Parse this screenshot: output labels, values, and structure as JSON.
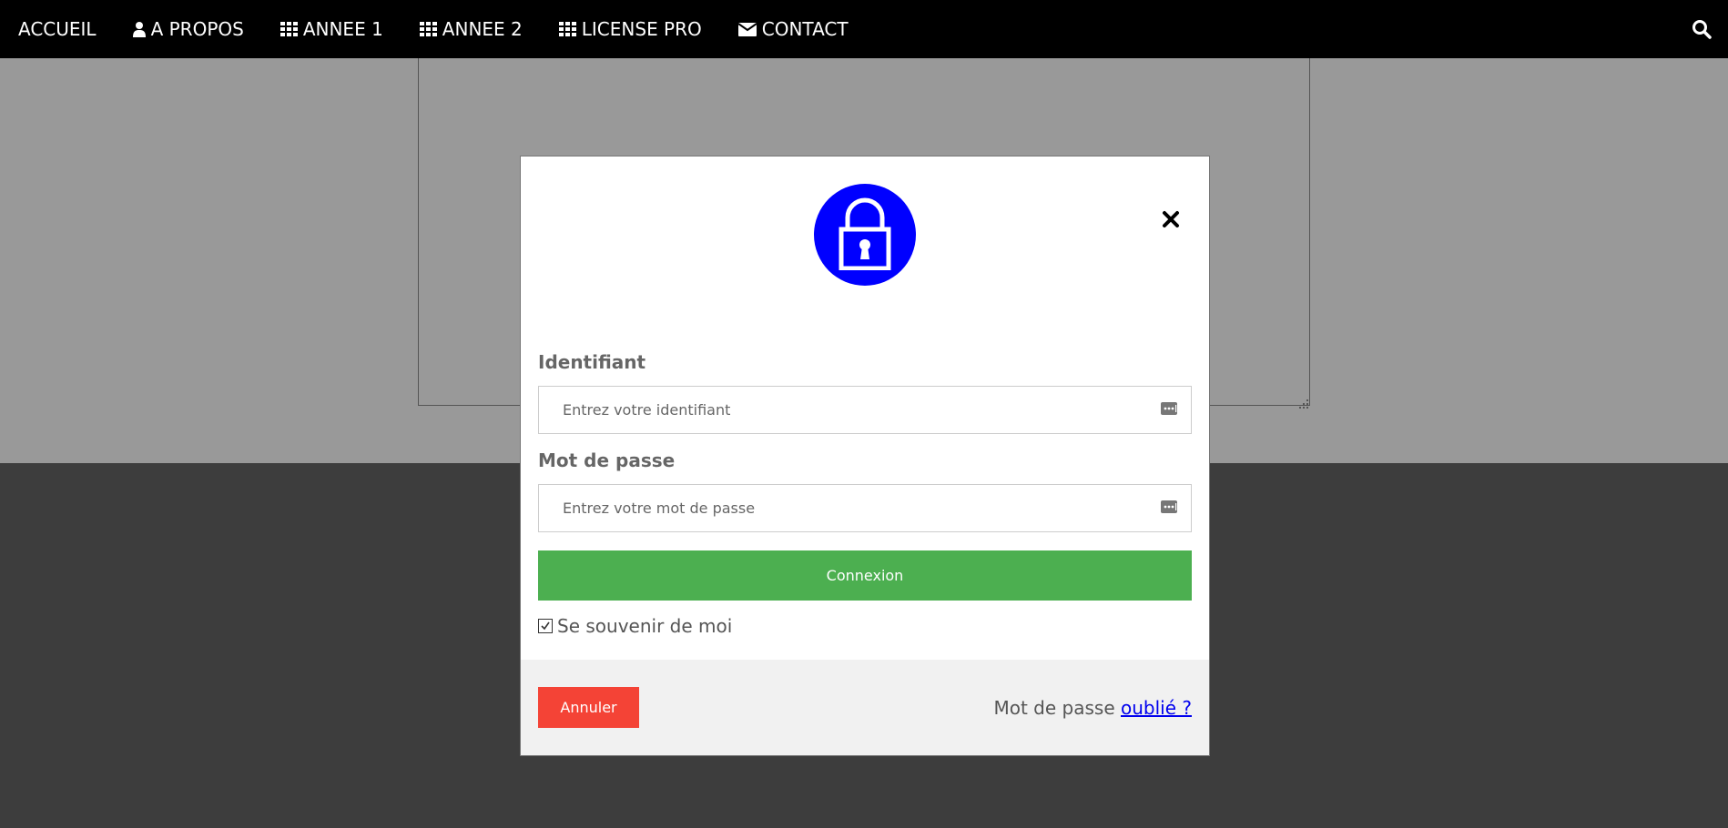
{
  "navbar": {
    "items": [
      {
        "label": "ACCUEIL",
        "icon": "none"
      },
      {
        "label": "A PROPOS",
        "icon": "user-icon"
      },
      {
        "label": "ANNEE 1",
        "icon": "grid-icon"
      },
      {
        "label": "ANNEE 2",
        "icon": "grid-icon"
      },
      {
        "label": "LICENSE PRO",
        "icon": "grid-icon"
      },
      {
        "label": "CONTACT",
        "icon": "envelope-icon"
      }
    ],
    "search_icon": "search-icon"
  },
  "modal": {
    "avatar_icon": "lock-icon",
    "close_icon": "close-icon",
    "username": {
      "label": "Identifiant",
      "placeholder": "Entrez votre identifiant",
      "value": ""
    },
    "password": {
      "label": "Mot de passe",
      "placeholder": "Entrez votre mot de passe",
      "value": ""
    },
    "login_button": "Connexion",
    "remember": {
      "label": "Se souvenir de moi",
      "checked": true
    },
    "footer": {
      "cancel_button": "Annuler",
      "forgot_prefix": "Mot de passe",
      "forgot_link": "oublié ?"
    }
  },
  "colors": {
    "navbar_bg": "#000000",
    "avatar_bg": "#0000ff",
    "login_button": "#4caf50",
    "cancel_button": "#f44336",
    "overlay_light": "#999999",
    "overlay_dark": "#3d3d3d",
    "footer_bg": "#f1f1f1",
    "link": "#0000ee"
  }
}
